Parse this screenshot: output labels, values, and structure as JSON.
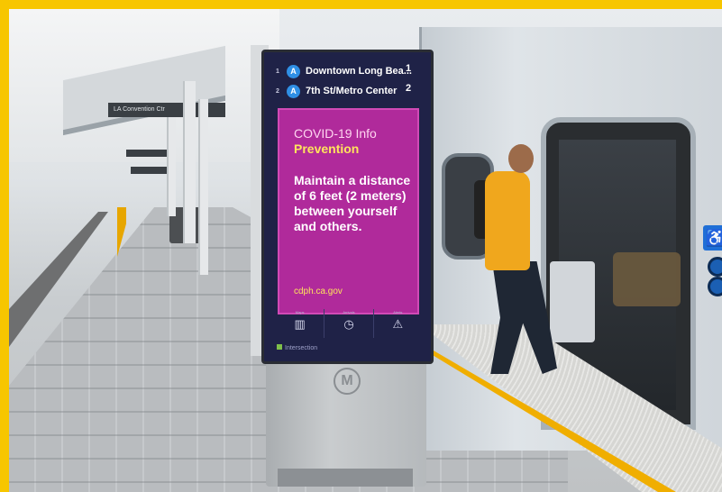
{
  "scene": {
    "frame_color": "#f7c600",
    "station_sign": "LA Convention Ctr"
  },
  "kiosk": {
    "routes": [
      {
        "index": "1",
        "line": "A",
        "destination": "Downtown Long Bea...",
        "eta": "1"
      },
      {
        "index": "2",
        "line": "A",
        "destination": "7th St/Metro Center",
        "eta": "2"
      }
    ],
    "alert": {
      "title": "COVID-19 Info",
      "subtitle": "Prevention",
      "message": "Maintain a distance of 6 feet (2 meters) between yourself and others.",
      "url": "cdph.ca.gov",
      "bg_color": "#b02a9b",
      "subtitle_color": "#ffe45c"
    },
    "tiles": [
      {
        "label": "Maps",
        "icon": "map-icon"
      },
      {
        "label": "Arrivals",
        "icon": "clock-icon"
      },
      {
        "label": "Alerts",
        "icon": "warning-icon"
      }
    ],
    "brand": "Intersection",
    "logo_letter": "M"
  },
  "train": {
    "accessibility_icon": "wheelchair-icon"
  }
}
